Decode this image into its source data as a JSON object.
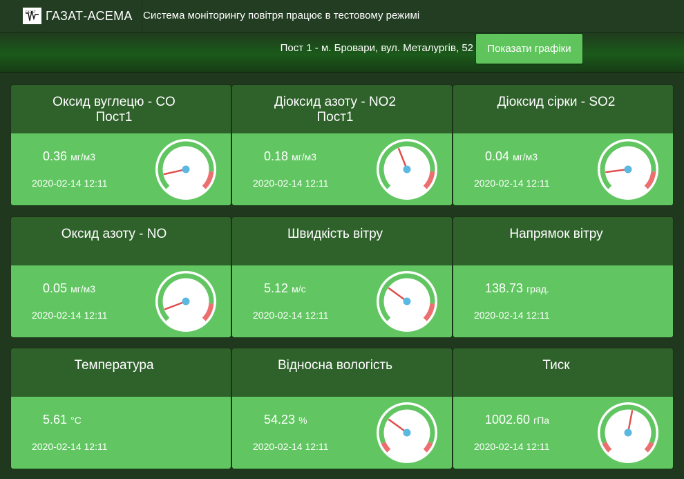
{
  "header": {
    "brand_logo_text": "ГАЗАТ",
    "brand_title": "ГАЗАТ-АСЕМА",
    "notice": "Система моніторингу повітря працює в тестовому режимі"
  },
  "subheader": {
    "post_label": "Пост 1 - м. Бровари, вул. Металургів, 52",
    "show_charts_button": "Показати графіки"
  },
  "colors": {
    "header_bg": "#233d22",
    "card_head": "#2f612b",
    "card_body": "#61c661",
    "gauge_ok": "#61c661",
    "gauge_danger": "#ec6f6f",
    "needle": "#e05050",
    "hub": "#5bb8e0"
  },
  "cards": [
    {
      "title_line1": "Оксид вуглецю - CO",
      "title_line2": "Пост1",
      "value": "0.36",
      "unit": "мг/м3",
      "time": "2020-02-14 12:11",
      "gauge": {
        "shown": true,
        "fill": 0.12,
        "danger": "high"
      }
    },
    {
      "title_line1": "Діоксид азоту - NO2",
      "title_line2": "Пост1",
      "value": "0.18",
      "unit": "мг/м3",
      "time": "2020-02-14 12:11",
      "gauge": {
        "shown": true,
        "fill": 0.42,
        "danger": "high"
      }
    },
    {
      "title_line1": "Діоксид сірки - SO2",
      "title_line2": "",
      "value": "0.04",
      "unit": "мг/м3",
      "time": "2020-02-14 12:11",
      "gauge": {
        "shown": true,
        "fill": 0.14,
        "danger": "high"
      }
    },
    {
      "title_line1": "Оксид азоту - NO",
      "title_line2": "",
      "value": "0.05",
      "unit": "мг/м3",
      "time": "2020-02-14 12:11",
      "gauge": {
        "shown": true,
        "fill": 0.09,
        "danger": "high"
      }
    },
    {
      "title_line1": "Швидкість вітру",
      "title_line2": "",
      "value": "5.12",
      "unit": "м/с",
      "time": "2020-02-14 12:11",
      "gauge": {
        "shown": true,
        "fill": 0.3,
        "danger": "high"
      }
    },
    {
      "title_line1": "Напрямок вітру",
      "title_line2": "",
      "value": "138.73",
      "unit": "град.",
      "time": "2020-02-14 12:11",
      "gauge": {
        "shown": false
      }
    },
    {
      "title_line1": "Температура",
      "title_line2": "",
      "value": "5.61",
      "unit": "°C",
      "time": "2020-02-14 12:11",
      "gauge": {
        "shown": false
      }
    },
    {
      "title_line1": "Відносна вологість",
      "title_line2": "",
      "value": "54.23",
      "unit": "%",
      "time": "2020-02-14 12:11",
      "gauge": {
        "shown": true,
        "fill": 0.3,
        "danger": "both"
      }
    },
    {
      "title_line1": "Тиск",
      "title_line2": "",
      "value": "1002.60",
      "unit": "гПа",
      "time": "2020-02-14 12:11",
      "gauge": {
        "shown": true,
        "fill": 0.54,
        "danger": "both"
      }
    }
  ]
}
